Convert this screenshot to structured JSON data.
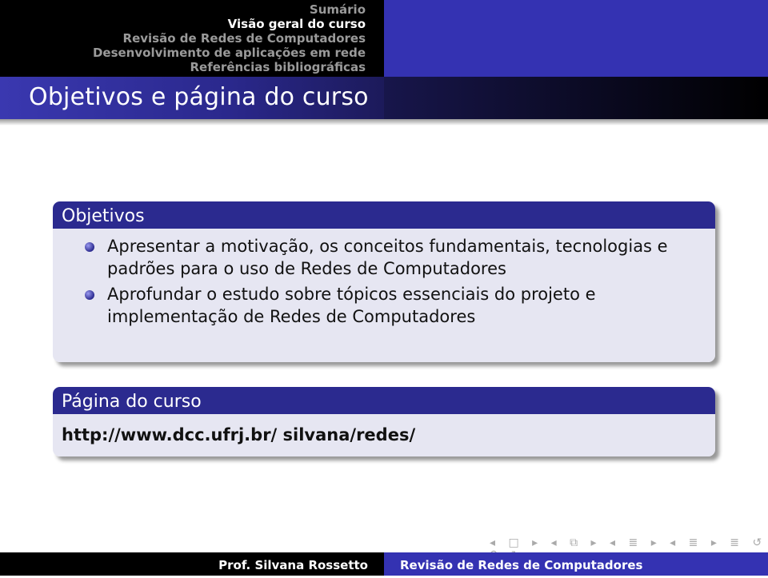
{
  "header": {
    "sections": [
      {
        "label": "Sumário",
        "active": false
      },
      {
        "label": "Visão geral do curso",
        "active": true
      },
      {
        "label": "Revisão de Redes de Computadores",
        "active": false
      },
      {
        "label": "Desenvolvimento de aplicações em rede",
        "active": false
      },
      {
        "label": "Referências bibliográficas",
        "active": false
      }
    ]
  },
  "slide": {
    "title": "Objetivos e página do curso",
    "blocks": [
      {
        "title": "Objetivos",
        "items": [
          "Apresentar a motivação, os conceitos fundamentais, tecnologias e padrões para o uso de Redes de Computadores",
          "Aprofundar o estudo sobre tópicos essenciais do projeto e implementação de Redes de Computadores"
        ]
      },
      {
        "title": "Página do curso",
        "url": "http://www.dcc.ufrj.br/ silvana/redes/"
      }
    ]
  },
  "nav": {
    "symbols": "◂ □ ▸ ◂ ⧉ ▸ ◂ ≣ ▸ ◂ ≣ ▸ ≣ ↺ ⚲ ↻"
  },
  "footer": {
    "author": "Prof. Silvana Rossetto",
    "course": "Revisão de Redes de Computadores"
  },
  "colors": {
    "block_header": "#2b2a8f",
    "block_body": "#e6e6f2",
    "header_right": "#3432b2"
  }
}
